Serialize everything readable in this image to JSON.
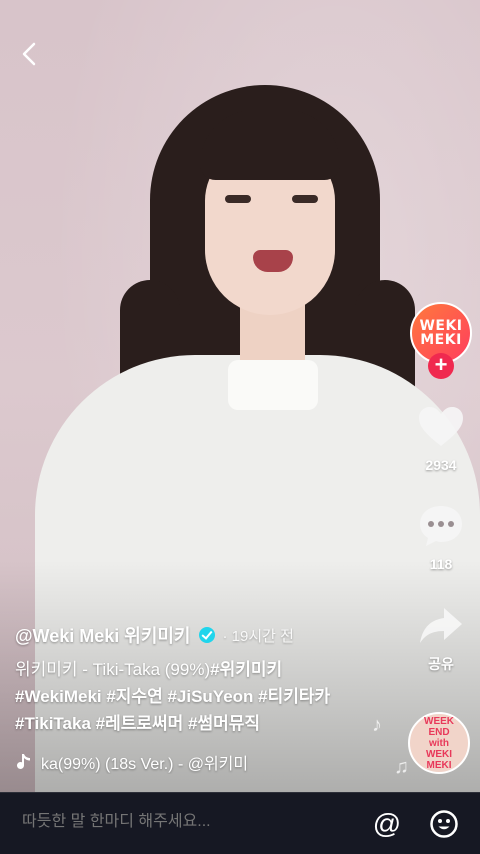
{
  "nav": {
    "back_icon": "chevron-left-icon"
  },
  "rail": {
    "avatar_text_1": "WEKI",
    "avatar_text_2": "MEKI",
    "follow_icon": "plus-icon",
    "like_count": "2934",
    "comment_count": "118",
    "share_label": "공유",
    "disc_lines": [
      "WEEK",
      "END",
      "with",
      "WEKI",
      "MEKI"
    ]
  },
  "post": {
    "author": "@Weki Meki 위키미키",
    "time": "· 19시간 전",
    "line1_text": "위키미키 - Tiki-Taka (99%)",
    "line1_tag": "#위키미키",
    "line2": "#WekiMeki #지수연 #JiSuYeon #티키타카",
    "line3": "#TikiTaka #레트로써머 #썸머뮤직",
    "music": "ka(99%) (18s Ver.)  - @위키미"
  },
  "comment": {
    "placeholder": "따듯한 말 한마디 해주세요..."
  },
  "colors": {
    "accent": "#f0294f",
    "verified": "#20d5ec",
    "bar": "#161823"
  }
}
